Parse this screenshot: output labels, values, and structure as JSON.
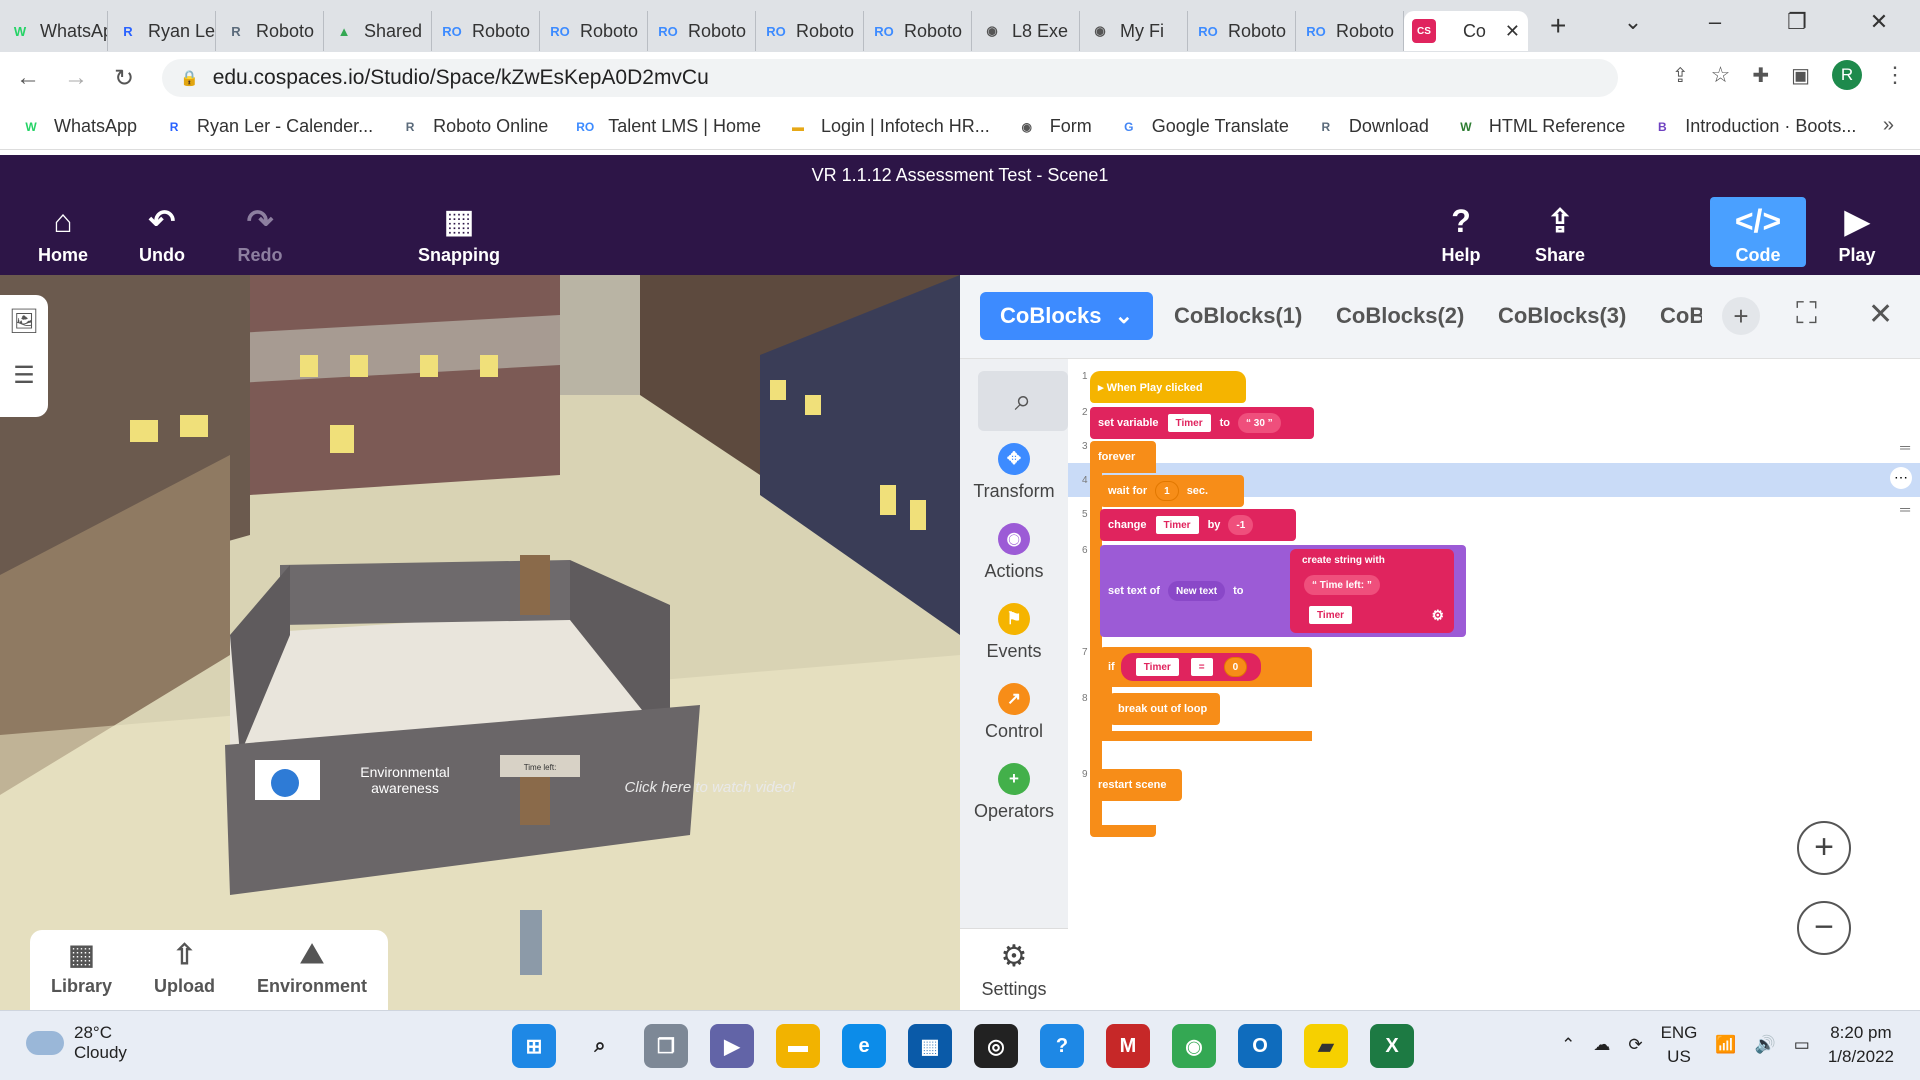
{
  "browser": {
    "tabs": [
      {
        "title": "WhatsApp",
        "color": "#25d366",
        "glyph": "W"
      },
      {
        "title": "Ryan Ler",
        "color": "#2962ff",
        "glyph": "R"
      },
      {
        "title": "Roboto",
        "color": "#5b6b7b",
        "glyph": "R"
      },
      {
        "title": "Shared",
        "color": "#34a853",
        "glyph": "▲"
      },
      {
        "title": "Roboto",
        "color": "#3d8bff",
        "glyph": "RO"
      },
      {
        "title": "Roboto",
        "color": "#3d8bff",
        "glyph": "RO"
      },
      {
        "title": "Roboto",
        "color": "#3d8bff",
        "glyph": "RO"
      },
      {
        "title": "Roboto",
        "color": "#3d8bff",
        "glyph": "RO"
      },
      {
        "title": "Roboto",
        "color": "#3d8bff",
        "glyph": "RO"
      },
      {
        "title": "L8 Exe",
        "color": "#555555",
        "glyph": "◉"
      },
      {
        "title": "My Fi",
        "color": "#555555",
        "glyph": "◉"
      },
      {
        "title": "Roboto",
        "color": "#3d8bff",
        "glyph": "RO"
      },
      {
        "title": "Roboto",
        "color": "#3d8bff",
        "glyph": "RO"
      }
    ],
    "active_tab": {
      "title": "Co",
      "glyph": "CS",
      "color": "#e0245e"
    },
    "url": "edu.cospaces.io/Studio/Space/kZwEsKepA0D2mvCu",
    "avatar_letter": "R",
    "bookmarks": [
      {
        "label": "WhatsApp",
        "color": "#25d366",
        "glyph": "W"
      },
      {
        "label": "Ryan Ler - Calender...",
        "color": "#2962ff",
        "glyph": "R"
      },
      {
        "label": "Roboto Online",
        "color": "#5b6b7b",
        "glyph": "R"
      },
      {
        "label": "Talent LMS | Home",
        "color": "#3d8bff",
        "glyph": "RO"
      },
      {
        "label": "Login | Infotech HR...",
        "color": "#e6a817",
        "glyph": "▬"
      },
      {
        "label": "Form",
        "color": "#555555",
        "glyph": "◉"
      },
      {
        "label": "Google Translate",
        "color": "#4285f4",
        "glyph": "G"
      },
      {
        "label": "Download",
        "color": "#5b6b7b",
        "glyph": "R"
      },
      {
        "label": "HTML Reference",
        "color": "#2e7d32",
        "glyph": "W"
      },
      {
        "label": "Introduction · Boots...",
        "color": "#6f42c1",
        "glyph": "B"
      }
    ]
  },
  "app": {
    "scene_title": "VR 1.1.12 Assessment Test - Scene1",
    "toolbar": {
      "home": "Home",
      "undo": "Undo",
      "redo": "Redo",
      "snapping": "Snapping",
      "help": "Help",
      "share": "Share",
      "code": "Code",
      "play": "Play"
    },
    "bottom_panel": {
      "library": "Library",
      "upload": "Upload",
      "environment": "Environment"
    },
    "scene_labels": {
      "env": "Environmental awareness",
      "time": "Time left:",
      "video": "Click here to watch video!"
    }
  },
  "code": {
    "tabs": [
      "CoBlocks",
      "CoBlocks(1)",
      "CoBlocks(2)",
      "CoBlocks(3)",
      "CoBl"
    ],
    "palette": [
      {
        "label": "Transform",
        "color": "#3d8bff",
        "glyph": "✥"
      },
      {
        "label": "Actions",
        "color": "#9c5bd6",
        "glyph": "◉"
      },
      {
        "label": "Events",
        "color": "#f5b400",
        "glyph": "⚑"
      },
      {
        "label": "Control",
        "color": "#f78d18",
        "glyph": "↗"
      },
      {
        "label": "Operators",
        "color": "#43b04a",
        "glyph": "+"
      }
    ],
    "settings": "Settings",
    "lines": [
      "1",
      "2",
      "3",
      "4",
      "5",
      "6",
      "7",
      "8",
      "9"
    ],
    "blocks": {
      "when_play": "▸ When Play clicked",
      "set_variable": "set variable",
      "var_timer": "Timer",
      "to": "to",
      "value_30": "“ 30 ”",
      "forever": "forever",
      "wait_for": "wait for",
      "wait_val": "1",
      "sec": "sec.",
      "change": "change",
      "by": "by",
      "change_val": "-1",
      "set_text_of": "set text of",
      "new_text": "New text",
      "create_string": "create string with",
      "time_left": "“ Time left: ”",
      "if": "if",
      "eq": "=",
      "zero": "0",
      "break": "break out of loop",
      "restart": "restart scene"
    }
  },
  "taskbar": {
    "temp": "28°C",
    "weather": "Cloudy",
    "lang1": "ENG",
    "lang2": "US",
    "time": "8:20 pm",
    "date": "1/8/2022"
  }
}
